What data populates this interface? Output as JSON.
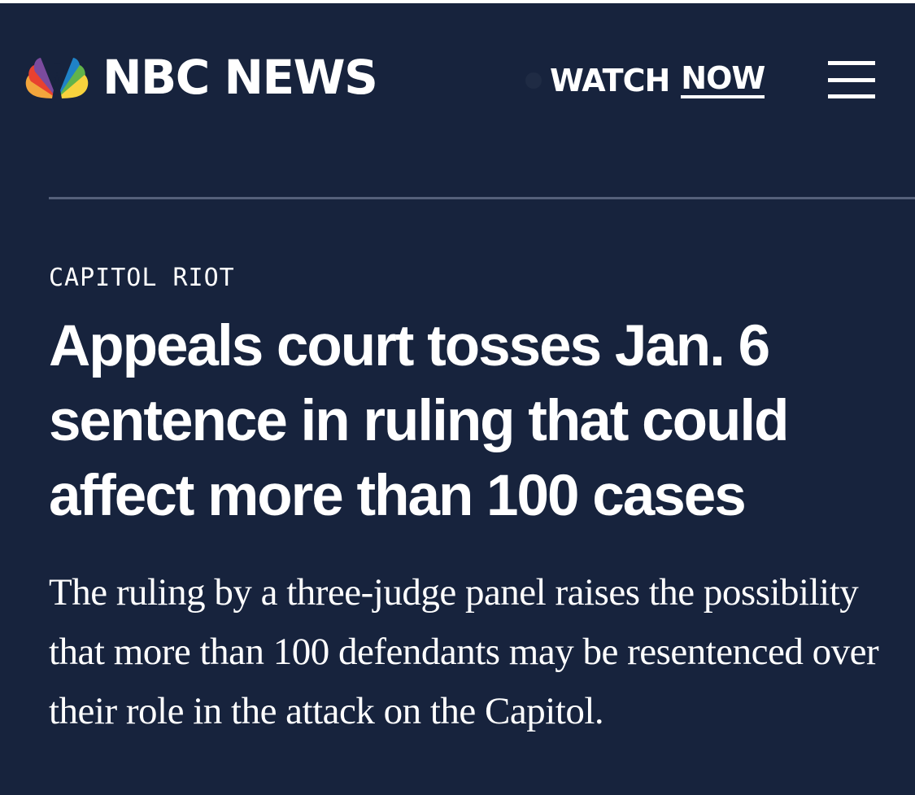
{
  "header": {
    "brand": "NBC NEWS",
    "logo_icon": "nbc-peacock-icon",
    "watch": "WATCH",
    "now": "NOW",
    "menu_icon": "hamburger-menu-icon"
  },
  "article": {
    "category": "CAPITOL RIOT",
    "headline": "Appeals court tosses Jan. 6 sentence in ruling that could affect more than 100 cases",
    "dek": "The ruling by a three-judge panel raises the possibility that more than 100 defendants may be resentenced over their role in the attack on the Capitol."
  },
  "colors": {
    "background": "#17233d",
    "text": "#ffffff",
    "divider": "#55607a",
    "peacock": [
      "#f2a53c",
      "#e8412f",
      "#7b4b9e",
      "#1f82c7",
      "#62b34a",
      "#f7d23d"
    ]
  }
}
